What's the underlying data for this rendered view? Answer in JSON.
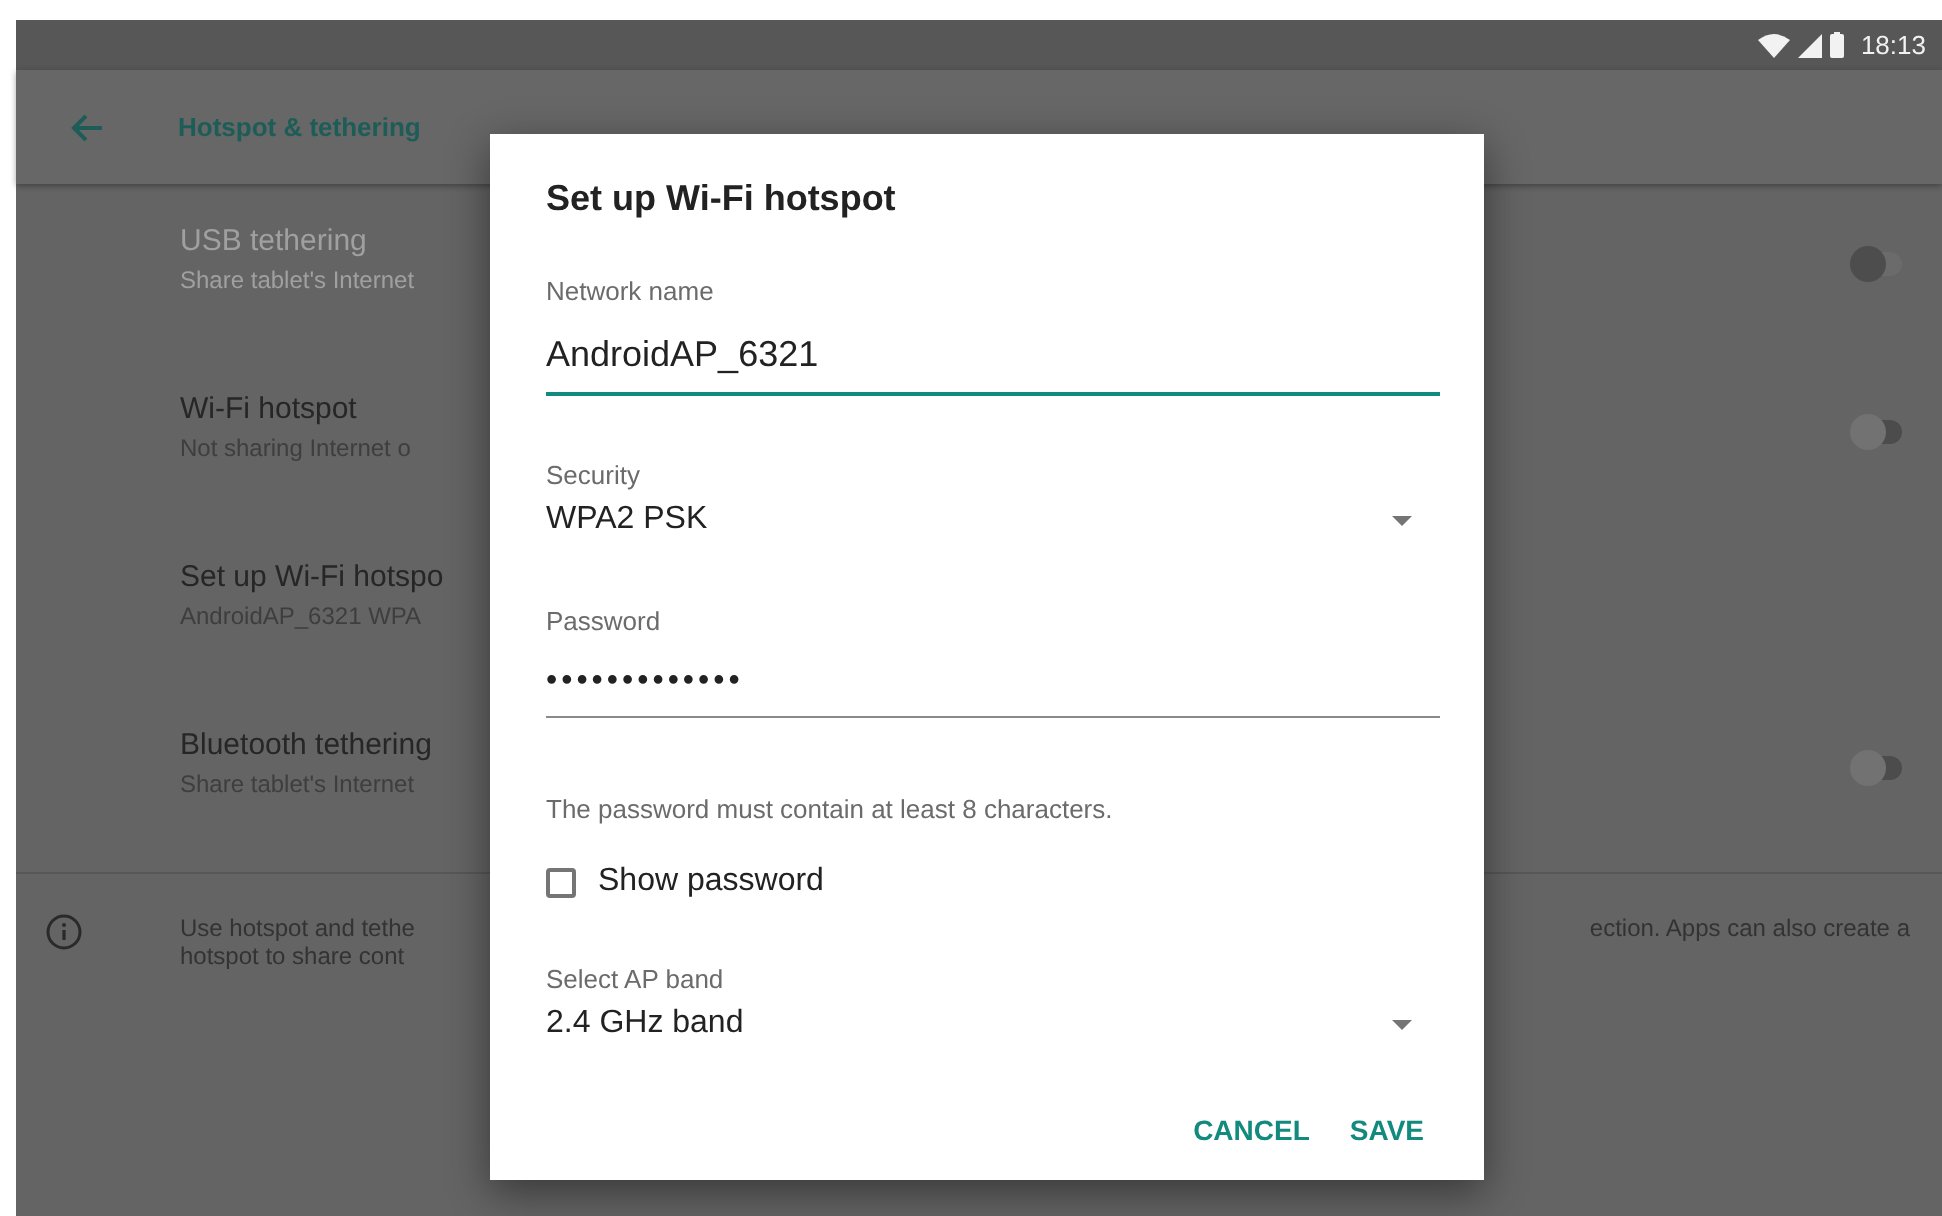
{
  "status_bar": {
    "time": "18:13"
  },
  "toolbar": {
    "title": "Hotspot & tethering"
  },
  "settings": [
    {
      "title": "USB tethering",
      "summary": "Share tablet's Internet",
      "disabled": true,
      "on": false
    },
    {
      "title": "Wi-Fi hotspot",
      "summary": "Not sharing Internet o",
      "disabled": false,
      "on": false
    },
    {
      "title": "Set up Wi-Fi hotspo",
      "summary": "AndroidAP_6321 WPA",
      "disabled": false
    },
    {
      "title": "Bluetooth tethering",
      "summary": "Share tablet's Internet",
      "disabled": false,
      "on": false
    }
  ],
  "info": {
    "left_lines": [
      "Use hotspot and tethe",
      "hotspot to share cont"
    ],
    "right_text": "ection. Apps can also create a"
  },
  "dialog": {
    "title": "Set up Wi-Fi hotspot",
    "network_name": {
      "label": "Network name",
      "value": "AndroidAP_6321",
      "focused": true
    },
    "security": {
      "label": "Security",
      "value": "WPA2 PSK"
    },
    "password": {
      "label": "Password",
      "value": "•••••••••••••",
      "hint": "The password must contain at least 8 characters."
    },
    "show_password": {
      "label": "Show password",
      "checked": false
    },
    "ap_band": {
      "label": "Select AP band",
      "value": "2.4 GHz band"
    },
    "buttons": [
      "CANCEL",
      "SAVE"
    ]
  }
}
